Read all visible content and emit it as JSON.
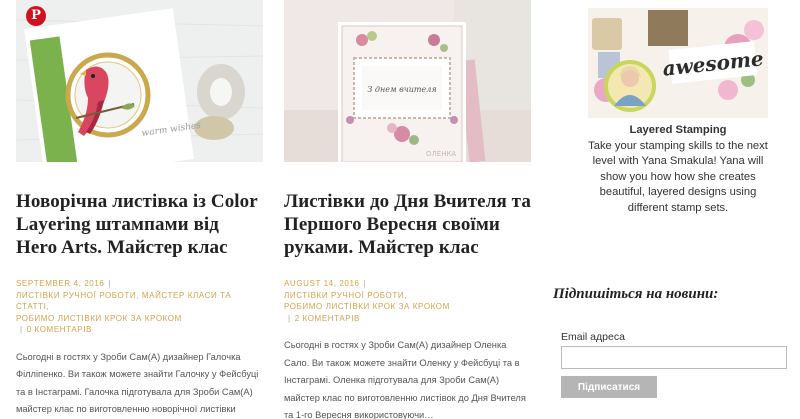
{
  "posts": [
    {
      "title": "Новорічна листівка із Color Layering штампами від Hero Arts. Майстер клас",
      "date": "SEPTEMBER 4, 2016",
      "categories": [
        "ЛИСТІВКИ РУЧНОЇ РОБОТИ",
        "МАЙСТЕР КЛАСИ ТА СТАТТІ",
        "РОБИМО ЛИСТІВКИ КРОК ЗА КРОКОМ"
      ],
      "comments": "0 КОМЕНТАРІВ",
      "excerpt": "Сьогодні в гостях у Зроби Сам(А) дизайнер Галочка Філліпенко. Ви також можете знайти Галочку у Фейсбуці та в Інстаграмі. Галочка підготувала для Зроби Сам(А) майстер клас по виготовленню новорічної листівки використовуючи Color Layering…",
      "image_text": "warm wishes",
      "pin_icon": "pinterest-icon"
    },
    {
      "title": "Листівки до Дня Вчителя та Першого Вересня своїми руками. Майстер клас",
      "date": "AUGUST 14, 2016",
      "categories": [
        "ЛИСТІВКИ РУЧНОЇ РОБОТИ",
        "РОБИМО ЛИСТІВКИ КРОК ЗА КРОКОМ"
      ],
      "comments": "2 КОМЕНТАРІВ",
      "excerpt": "Сьогодні в гостях у Зроби Сам(А) дизайнер Оленка Сало. Ви також можете знайти Оленку у Фейсбуці та в Інстаграмі. Оленка підготувала для Зроби Сам(А) майстер клас по виготовленню листівок до Дня Вчителя та 1-го Вересня використовуючи…",
      "image_text": "З днем вчителя",
      "watermark": "ОЛЕНКА"
    }
  ],
  "sidebar": {
    "ad": {
      "image_text": "awesome",
      "title": "Layered Stamping",
      "body": "Take your stamping skills to the next level with Yana Smakula! Yana will show you how how she creates beautiful, layered designs using different stamp sets."
    },
    "subscribe": {
      "title": "Підпишіться на новини:",
      "email_label": "Email адреса",
      "email_value": "",
      "email_placeholder": "",
      "button": "Підписатися"
    }
  },
  "colors": {
    "meta": "#d4a34a",
    "button": "#b5b5b5",
    "pinterest": "#d0121f"
  }
}
